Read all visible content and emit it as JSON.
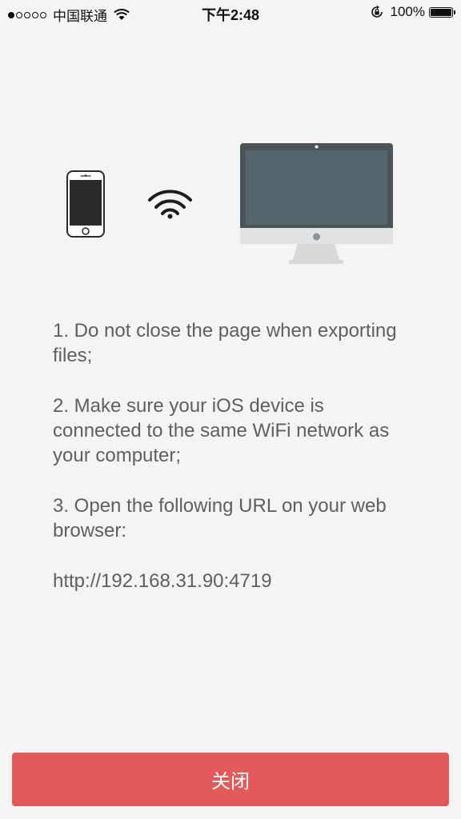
{
  "status_bar": {
    "carrier": "中国联通",
    "time": "下午2:48",
    "battery_percent": "100%",
    "signal_strength_dots": 1,
    "battery_level": 1.0
  },
  "instructions": {
    "step1": "1. Do not close the page when exporting files;",
    "step2": "2. Make sure your iOS device is connected to the same WiFi network as your computer;",
    "step3": "3. Open the following URL on your web browser:",
    "url": "http://192.168.31.90:4719"
  },
  "footer": {
    "close_label": "关闭"
  },
  "colors": {
    "background": "#f4f4f4",
    "close_button": "#e35a5a",
    "screen": "#56656b",
    "monitor_frame": "#4a5358",
    "text": "#5f5f5f"
  },
  "icons": {
    "phone": "smartphone-icon",
    "wifi": "wifi-icon",
    "computer": "desktop-monitor-icon"
  }
}
